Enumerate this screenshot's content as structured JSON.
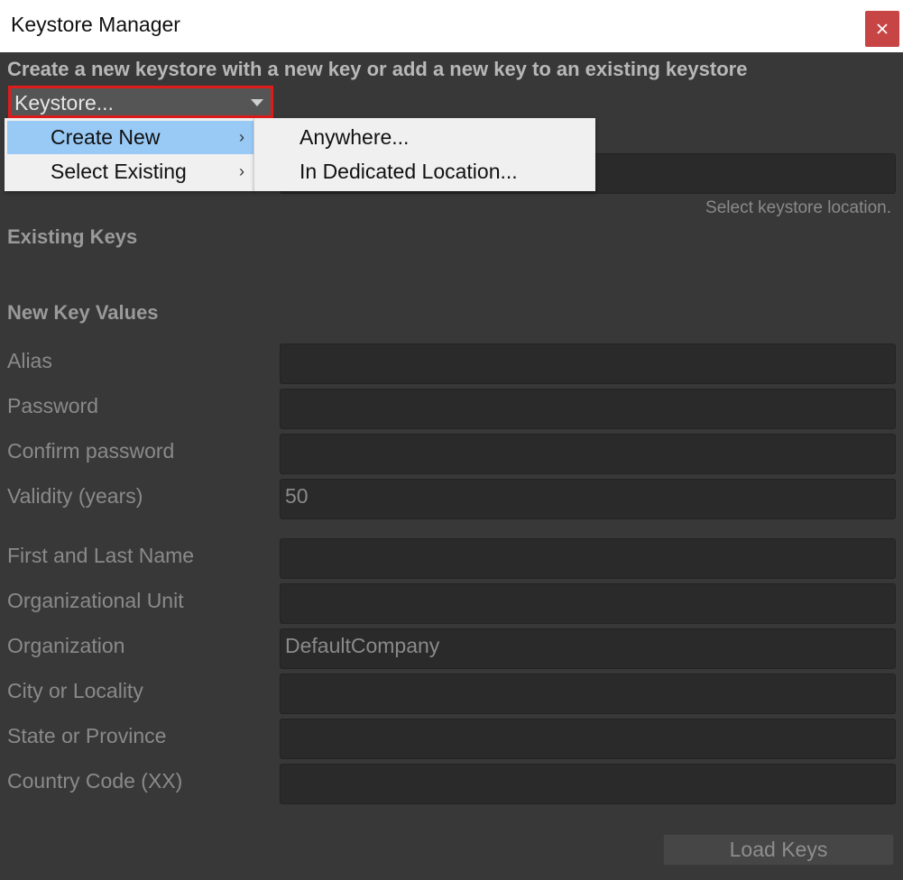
{
  "window": {
    "title": "Keystore Manager",
    "close_symbol": "✕"
  },
  "heading": "Create a new keystore with a new key or add a new key to an existing keystore",
  "keystore_dropdown": {
    "label": "Keystore...",
    "highlight_color": "#e01b1b"
  },
  "context_menu": {
    "items": [
      {
        "label": "Create New",
        "has_submenu": true,
        "active": true
      },
      {
        "label": "Select Existing",
        "has_submenu": true,
        "active": false
      }
    ],
    "submenu_items": [
      {
        "label": "Anywhere..."
      },
      {
        "label": "In Dedicated Location..."
      }
    ],
    "active_color": "#99c9f5"
  },
  "location_hint": "Select keystore location.",
  "sections": {
    "existing_keys": "Existing Keys",
    "new_key_values": "New Key Values"
  },
  "fields": {
    "alias": {
      "label": "Alias",
      "value": ""
    },
    "password": {
      "label": "Password",
      "value": ""
    },
    "confirm_password": {
      "label": "Confirm password",
      "value": ""
    },
    "validity": {
      "label": "Validity (years)",
      "value": "50"
    },
    "first_last_name": {
      "label": "First and Last Name",
      "value": ""
    },
    "org_unit": {
      "label": "Organizational Unit",
      "value": ""
    },
    "organization": {
      "label": "Organization",
      "value": "DefaultCompany"
    },
    "city": {
      "label": "City or Locality",
      "value": ""
    },
    "state": {
      "label": "State or Province",
      "value": ""
    },
    "country": {
      "label": "Country Code (XX)",
      "value": ""
    }
  },
  "load_keys_button": "Load Keys"
}
